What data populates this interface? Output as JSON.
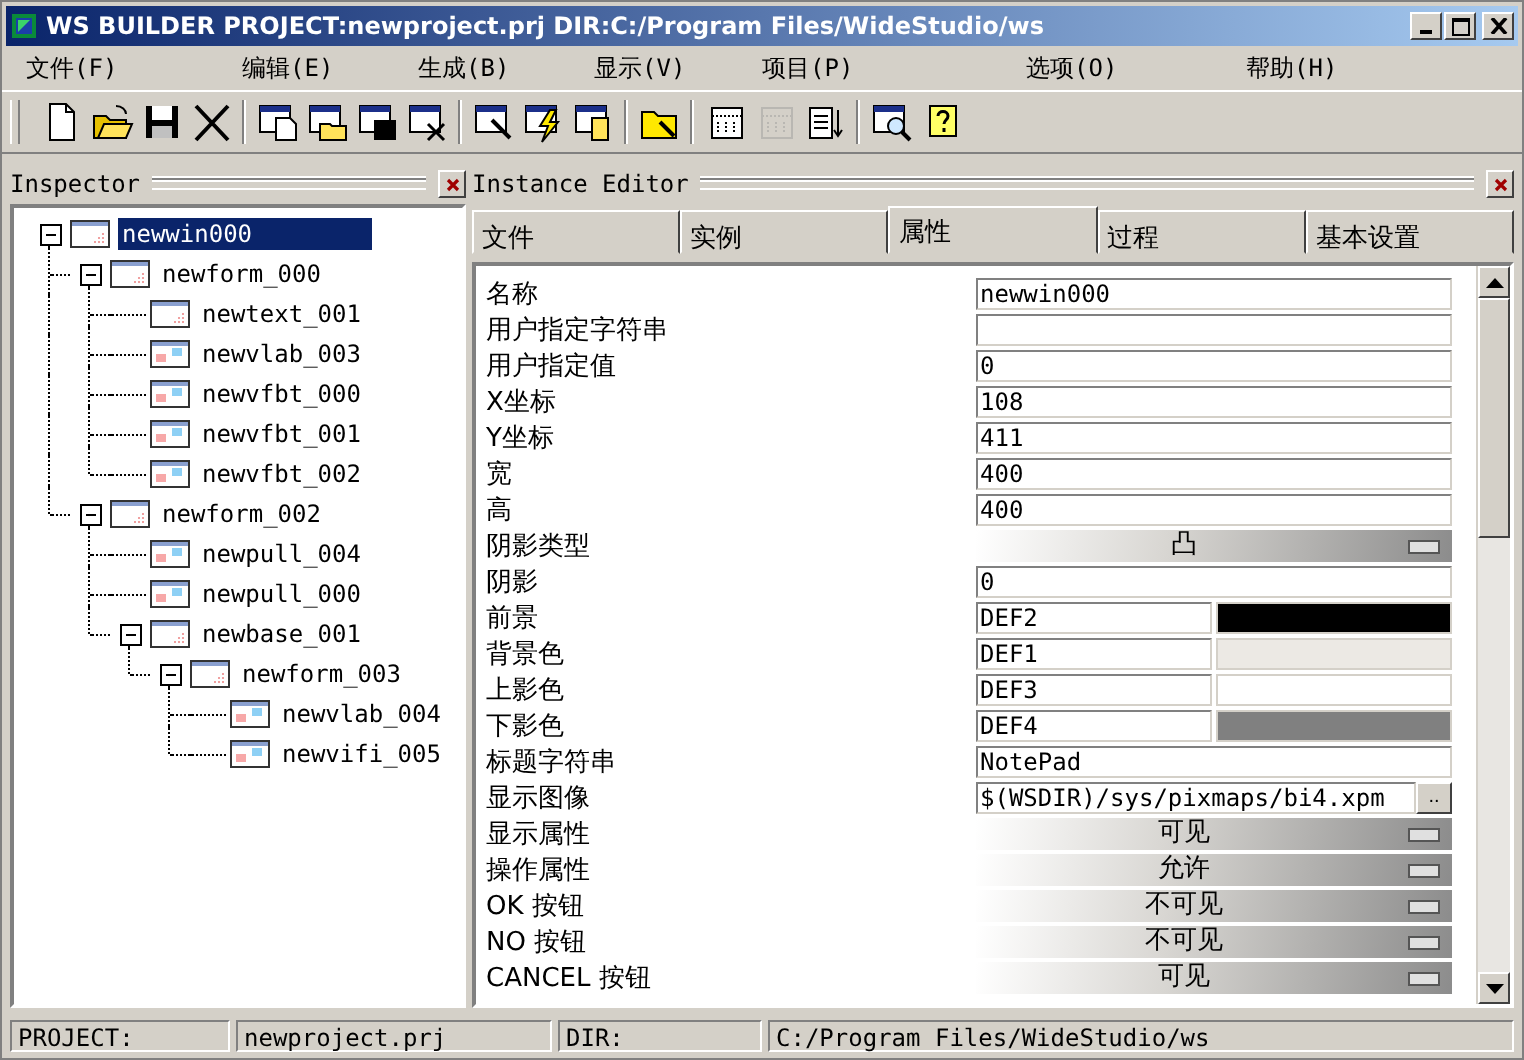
{
  "window": {
    "title": "WS BUILDER PROJECT:newproject.prj DIR:C:/Program Files/WideStudio/ws"
  },
  "menu": [
    {
      "label": "文件(F)"
    },
    {
      "label": "编辑(E)"
    },
    {
      "label": "生成(B)"
    },
    {
      "label": "显示(V)"
    },
    {
      "label": "项目(P)"
    },
    {
      "label": "选项(O)"
    },
    {
      "label": "帮助(H)"
    }
  ],
  "toolbar": [
    [
      {
        "kind": "new",
        "disabled": false
      },
      {
        "kind": "open",
        "disabled": false
      },
      {
        "kind": "save",
        "disabled": false
      },
      {
        "kind": "cut",
        "disabled": false
      }
    ],
    [
      {
        "kind": "win-new",
        "disabled": false
      },
      {
        "kind": "win-open",
        "disabled": false
      },
      {
        "kind": "win-save",
        "disabled": false
      },
      {
        "kind": "win-close",
        "disabled": false
      }
    ],
    [
      {
        "kind": "win-edit",
        "disabled": false
      },
      {
        "kind": "win-bolt",
        "disabled": false
      },
      {
        "kind": "win-build",
        "disabled": false
      }
    ],
    [
      {
        "kind": "folder-edit",
        "disabled": false
      }
    ],
    [
      {
        "kind": "grid",
        "disabled": false
      },
      {
        "kind": "grid",
        "disabled": true
      },
      {
        "kind": "list",
        "disabled": false
      }
    ],
    [
      {
        "kind": "preview",
        "disabled": false
      },
      {
        "kind": "help",
        "disabled": false
      }
    ]
  ],
  "inspector": {
    "title": "Inspector",
    "tree": [
      {
        "label": "newwin000",
        "kind": "form",
        "selected": true,
        "expanded": true,
        "children": [
          {
            "label": "newform_000",
            "kind": "form",
            "selected": false,
            "expanded": true,
            "children": [
              {
                "label": "newtext_001",
                "kind": "form",
                "selected": false
              },
              {
                "label": "newvlab_003",
                "kind": "widget",
                "selected": false
              },
              {
                "label": "newvfbt_000",
                "kind": "widget",
                "selected": false
              },
              {
                "label": "newvfbt_001",
                "kind": "widget",
                "selected": false
              },
              {
                "label": "newvfbt_002",
                "kind": "widget",
                "selected": false
              }
            ]
          },
          {
            "label": "newform_002",
            "kind": "form",
            "selected": false,
            "expanded": true,
            "children": [
              {
                "label": "newpull_004",
                "kind": "widget",
                "selected": false
              },
              {
                "label": "newpull_000",
                "kind": "widget",
                "selected": false
              },
              {
                "label": "newbase_001",
                "kind": "form",
                "selected": false,
                "expanded": true,
                "children": [
                  {
                    "label": "newform_003",
                    "kind": "form",
                    "selected": false,
                    "expanded": true,
                    "children": [
                      {
                        "label": "newvlab_004",
                        "kind": "widget",
                        "selected": false
                      },
                      {
                        "label": "newvifi_005",
                        "kind": "widget",
                        "selected": false
                      }
                    ]
                  }
                ]
              }
            ]
          }
        ]
      }
    ]
  },
  "editor": {
    "title": "Instance Editor",
    "tabs": [
      {
        "label": "文件",
        "selected": false
      },
      {
        "label": "实例",
        "selected": false
      },
      {
        "label": "属性",
        "selected": true
      },
      {
        "label": "过程",
        "selected": false
      },
      {
        "label": "基本设置",
        "selected": false
      }
    ],
    "properties": [
      {
        "label": "名称",
        "kind": "text",
        "value": "newwin000"
      },
      {
        "label": "用户指定字符串",
        "kind": "text"
      },
      {
        "label": "用户指定值",
        "kind": "text",
        "value": "0"
      },
      {
        "label": "X坐标",
        "kind": "text",
        "value": "108"
      },
      {
        "label": "Y坐标",
        "kind": "text",
        "value": "411"
      },
      {
        "label": "宽",
        "kind": "text",
        "value": "400"
      },
      {
        "label": "高",
        "kind": "text",
        "value": "400"
      },
      {
        "label": "阴影类型",
        "kind": "choice",
        "value": "凸"
      },
      {
        "label": "阴影",
        "kind": "text",
        "value": "0"
      },
      {
        "label": "前景",
        "kind": "color",
        "value": "DEF2",
        "color": "#000000"
      },
      {
        "label": "背景色",
        "kind": "color",
        "value": "DEF1",
        "color": "#ece9e4"
      },
      {
        "label": "上影色",
        "kind": "color",
        "value": "DEF3",
        "color": "#ffffff"
      },
      {
        "label": "下影色",
        "kind": "color",
        "value": "DEF4",
        "color": "#808080"
      },
      {
        "label": "标题字符串",
        "kind": "text",
        "value": "NotePad"
      },
      {
        "label": "显示图像",
        "kind": "file",
        "value": "$(WSDIR)/sys/pixmaps/bi4.xpm",
        "button": ".."
      },
      {
        "label": "显示属性",
        "kind": "choice",
        "value": "可见"
      },
      {
        "label": "操作属性",
        "kind": "choice",
        "value": "允许"
      },
      {
        "label": "OK 按钮",
        "kind": "choice",
        "value": "不可见"
      },
      {
        "label": "NO 按钮",
        "kind": "choice",
        "value": "不可见"
      },
      {
        "label": "CANCEL 按钮",
        "kind": "choice",
        "value": "可见"
      }
    ]
  },
  "status_bar": [
    {
      "label": "PROJECT:"
    },
    {
      "label": "newproject.prj"
    },
    {
      "label": "DIR:"
    },
    {
      "label": "C:/Program Files/WideStudio/ws"
    }
  ]
}
